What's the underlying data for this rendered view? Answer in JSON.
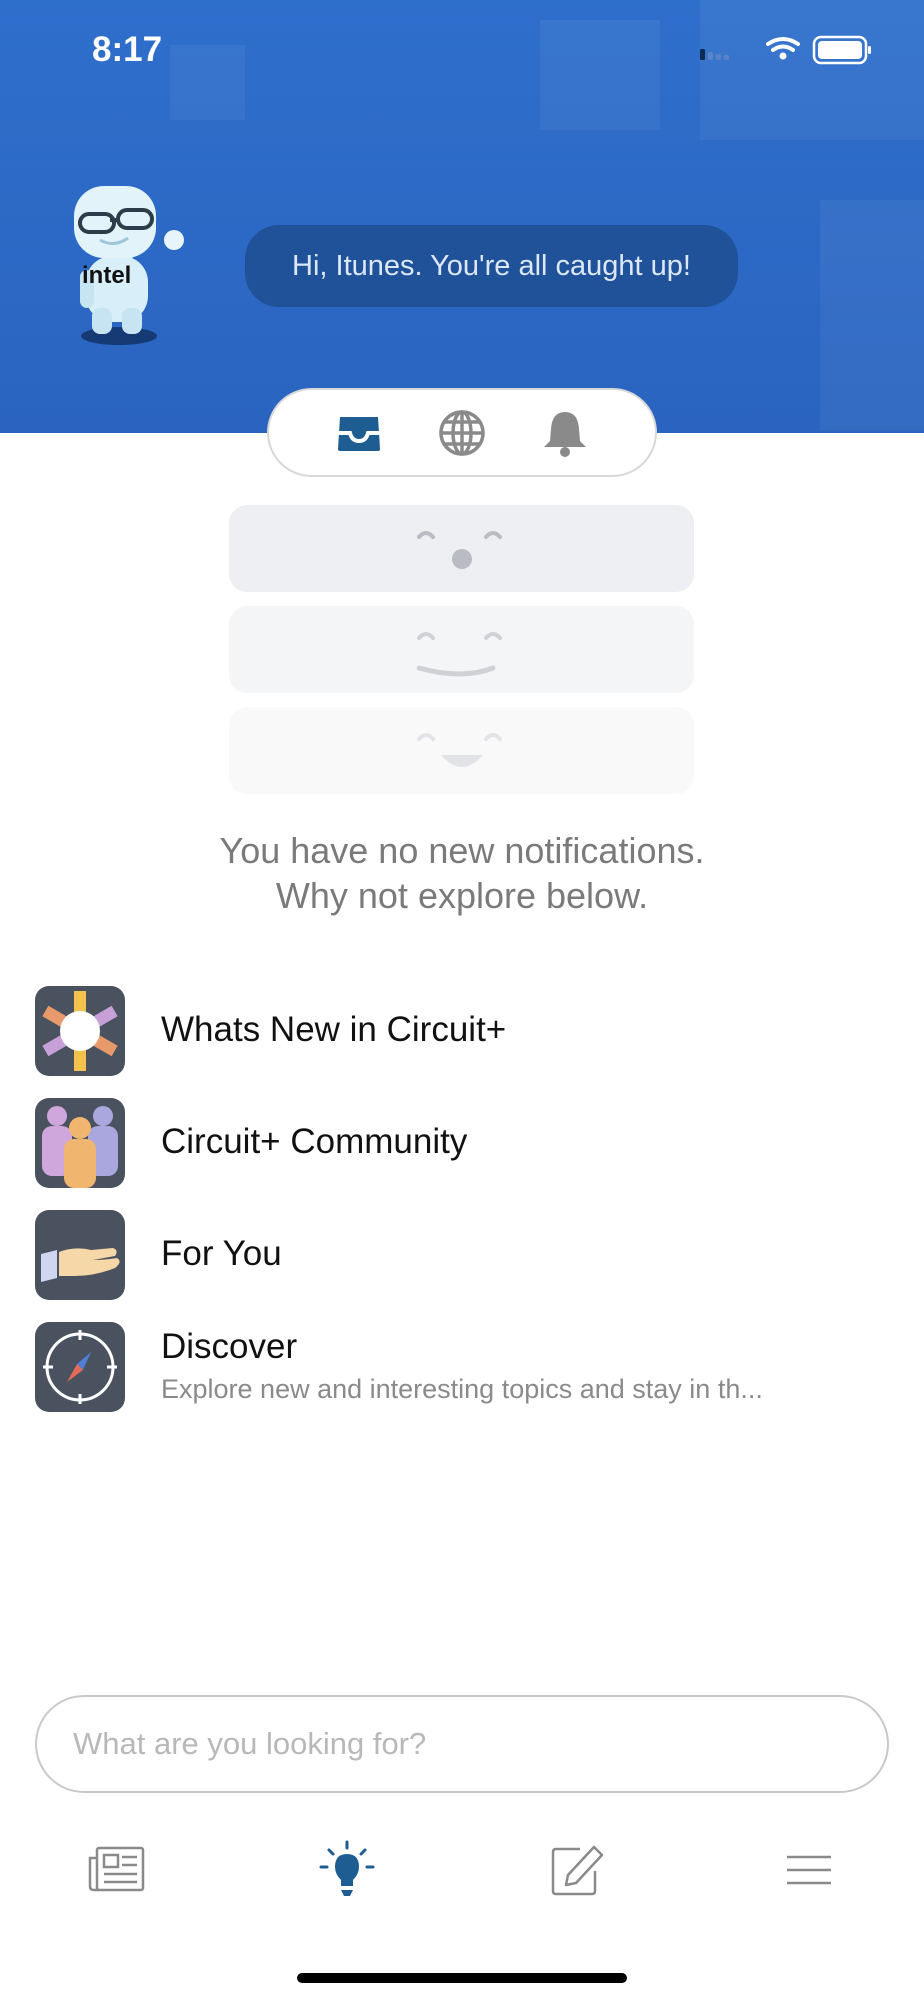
{
  "status_bar": {
    "time": "8:17"
  },
  "header": {
    "greeting": "Hi, Itunes. You're all caught up!",
    "mascot_badge": "intel"
  },
  "segments": [
    {
      "icon": "inbox-icon",
      "selected": true
    },
    {
      "icon": "globe-icon",
      "selected": false
    },
    {
      "icon": "bell-icon",
      "selected": false
    }
  ],
  "empty_state": {
    "line1": "You have no new notifications.",
    "line2": "Why not explore below."
  },
  "menu": [
    {
      "label": "Whats New in Circuit+",
      "icon": "sunburst-icon"
    },
    {
      "label": "Circuit+ Community",
      "icon": "people-icon"
    },
    {
      "label": "For You",
      "icon": "hand-icon"
    },
    {
      "label": "Discover",
      "subtitle": "Explore new and interesting topics and stay in th...",
      "icon": "compass-icon"
    }
  ],
  "search": {
    "placeholder": "What are you looking for?",
    "value": ""
  },
  "tabbar": [
    {
      "icon": "newspaper-icon",
      "active": false
    },
    {
      "icon": "lightbulb-icon",
      "active": true
    },
    {
      "icon": "compose-icon",
      "active": false
    },
    {
      "icon": "hamburger-menu-icon",
      "active": false
    }
  ],
  "colors": {
    "header_blue": "#2f6fcc",
    "bubble_blue": "#1f5298",
    "accent": "#1e5d92",
    "icon_gray": "#8a8a8a"
  }
}
